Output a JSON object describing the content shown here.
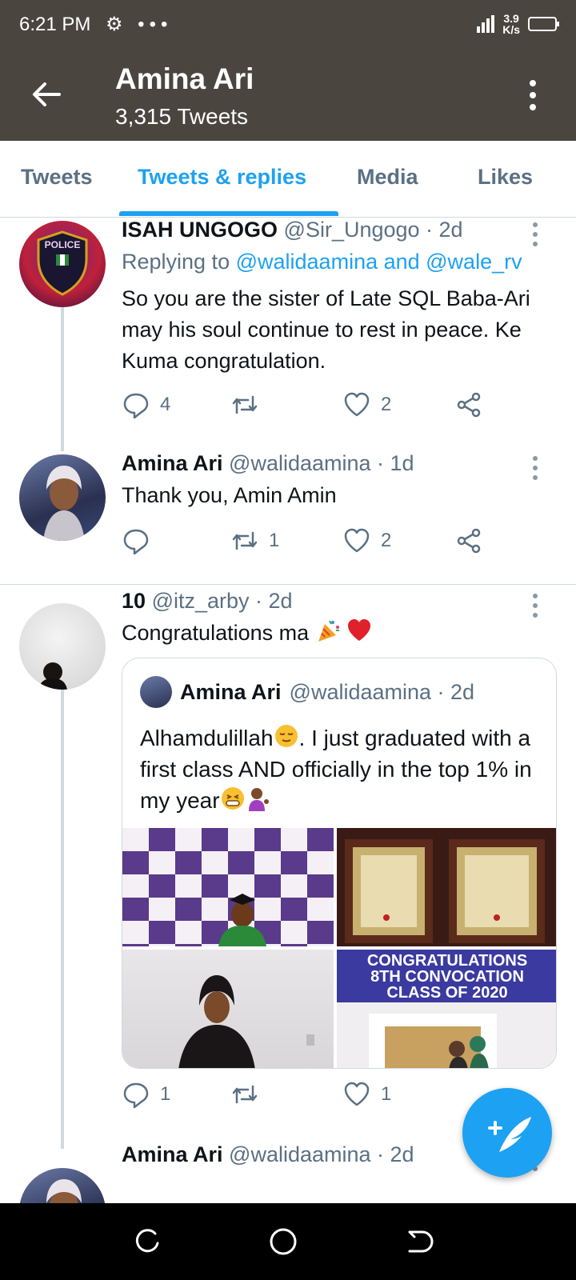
{
  "status_bar": {
    "time": "6:21 PM",
    "extra_icons": "⚙ •••",
    "net_speed": "3.9",
    "net_unit": "K/s"
  },
  "header": {
    "title": "Amina Ari",
    "subtitle": "3,315 Tweets"
  },
  "tabs": [
    {
      "label": "Tweets"
    },
    {
      "label": "Tweets & replies"
    },
    {
      "label": "Media"
    },
    {
      "label": "Likes"
    }
  ],
  "tweets": [
    {
      "name": "ISAH UNGOGO",
      "meta": "@Sir_Ungogo · 2d",
      "replying_prefix": "Replying to",
      "replying_mentions": "@walidaamina and @wale_rv",
      "text": "So you are the sister of Late SQL Baba-Ari may his soul continue to rest in peace. Ke Kuma congratulation.",
      "replies": "4",
      "retweets": "",
      "likes": "2"
    },
    {
      "name": "Amina Ari",
      "meta": "@walidaamina · 1d",
      "text": "Thank you, Amin Amin",
      "replies": "",
      "retweets": "1",
      "likes": "2"
    },
    {
      "name": "10",
      "meta": "@itz_arby · 2d",
      "text": "Congratulations ma",
      "replies": "1",
      "retweets": "",
      "likes": "1",
      "quote": {
        "name": "Amina Ari",
        "meta": "@walidaamina · 2d",
        "text_1": "Alhamdulillah",
        "text_2": ". I just graduated with a first class AND officially in the top 1% in my year",
        "banner_line_1": "CONGRATULATIONS",
        "banner_line_2": "8TH CONVOCATION",
        "banner_line_3": "CLASS OF 2020"
      }
    },
    {
      "name": "Amina Ari",
      "meta": "@walidaamina · 2d"
    }
  ],
  "colors": {
    "accent": "#1da1f2",
    "header_bg": "#4b4540",
    "muted": "#5b7083"
  }
}
